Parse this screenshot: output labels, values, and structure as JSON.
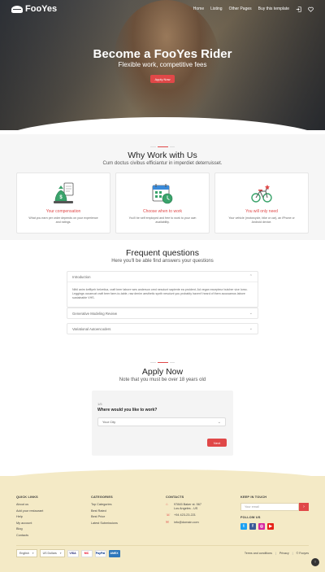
{
  "brand": {
    "name": "FooYes"
  },
  "nav": {
    "items": [
      "Home",
      "Listing",
      "Other Pages",
      "Buy this template"
    ]
  },
  "hero": {
    "title": "Become a FooYes Rider",
    "subtitle": "Flexible work, competitive fees",
    "button": "Apply Now"
  },
  "why": {
    "title": "Why Work with Us",
    "subtitle": "Cum doctus civibus efficiantur in imperdiet deterruisset.",
    "cards": [
      {
        "title": "Your compensation",
        "text": "What you earn per order depends on your experience and ratings.",
        "icon": "money-bag-icon"
      },
      {
        "title": "Choose when to work",
        "text": "You'll be self employed and free to work to your own availability.",
        "icon": "calendar-clock-icon"
      },
      {
        "title": "You will only need",
        "text": "Your vehicle (motorcycle, bike or car), an iPhone or Android device.",
        "icon": "bicycle-icon"
      }
    ]
  },
  "faq": {
    "title": "Frequent questions",
    "subtitle": "Here you'll be able find answers your questions",
    "items": [
      {
        "question": "Introduction",
        "answer": "Nihil anim keffiyeh helvetica, craft beer labore wes anderson cred nesciunt sapiente ea proident. Ad vegan excepteur butcher vice lomo. Leggings occaecat craft beer farm-to-table, raw denim aesthetic synth nesciunt you probably haven't heard of them accusamus labore sustainable VHS."
      },
      {
        "question": "Generative Modeling Review"
      },
      {
        "question": "Variational Autoencoders"
      }
    ]
  },
  "apply": {
    "title": "Apply Now",
    "subtitle": "Note that you must be over 18 years old",
    "step": "1/5",
    "question": "Where would you like to work?",
    "select_value": "Your City",
    "next_button": "Next"
  },
  "footer": {
    "quick_links": {
      "heading": "QUICK LINKS",
      "items": [
        "About us",
        "Add your restaurant",
        "Help",
        "My account",
        "Blog",
        "Contacts"
      ]
    },
    "categories": {
      "heading": "CATEGORIES",
      "items": [
        "Top Categories",
        "Best Rated",
        "Best Price",
        "Latest Submissions"
      ]
    },
    "contacts": {
      "heading": "CONTACTS",
      "address_line1": "97845 Baker st. 567",
      "address_line2": "Los Angeles - US",
      "phone": "+94 423-23-221",
      "email": "info@domain.com"
    },
    "keep_in_touch": {
      "heading": "KEEP IN TOUCH",
      "placeholder": "Your email",
      "follow_heading": "FOLLOW US"
    },
    "language": "English",
    "currency": "US Dollars",
    "payments": [
      "VISA",
      "MC",
      "PayPal",
      "AMEX"
    ],
    "legal": [
      "Terms and conditions",
      "Privacy",
      "© Fooyes"
    ]
  },
  "colors": {
    "accent": "#e04848",
    "footer_bg": "#f4eac6",
    "section_bg": "#f6f6f6"
  }
}
